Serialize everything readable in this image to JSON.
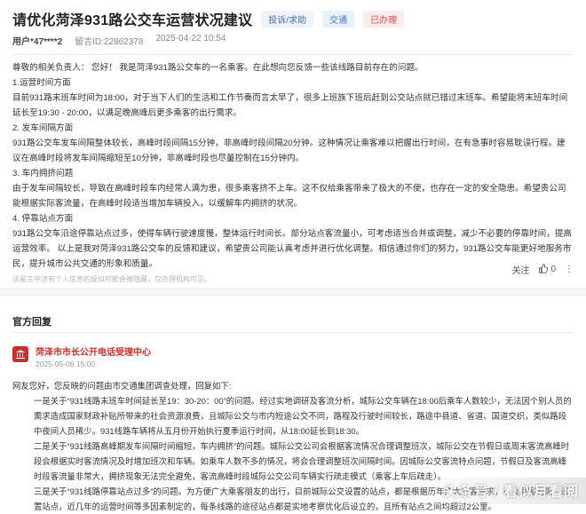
{
  "post": {
    "title": "请优化菏泽931路公交车运营状况建议",
    "tags": [
      "投诉/求助",
      "交通",
      "已办理"
    ],
    "user": "用户*47****2",
    "message_id": "留言ID:22862378",
    "datetime": "2025-04-22 10:54"
  },
  "content": {
    "greeting": "尊敬的相关负责人： 您好！ 我是菏泽931路公交车的一名乘客。在此想向您反馈一些该线路目前存在的问题。",
    "s1_title": "1.运营时间方面",
    "s1_body": "目前931路末班车时间为18:00，对于当下人们的生活和工作节奏而言太早了，很多上班族下班后赶到公交站点就已错过末班车。希望能将末班车时间延长至19:30 - 20:00，以满足晚高峰后更多乘客的出行需求。",
    "s2_title": "2. 发车间隔方面",
    "s2_body": "931路公交车发车间隔整体较长，高峰时段间隔15分钟，非高峰时段间隔20分钟。这种情况让乘客难以把握出行时间，在有急事时容易耽误行程。建议在高峰时段将发车间隔缩短至10分钟，非高峰时段也尽量控制在15分钟内。",
    "s3_title": "3. 车内拥挤问题",
    "s3_body": "由于发车间隔较长，导致在高峰时段车内经常人满为患，很多乘客挤不上车。这不仅给乘客带来了极大的不便，也存在一定的安全隐患。希望贵公司能根据实际客流量，在高峰时段适当增加车辆投入，以缓解车内拥挤的状况。",
    "s4_title": "4. 停靠站点方面",
    "s4_body": "931路公交车沿途停靠站点过多，使得车辆行驶速度慢，整体运行时间长。部分站点客流量小，可考虑适当合并或调整，减少不必要的停靠时间，提高运营效率。 以上是我对菏泽931路公交车的反馈和建议，希望贵公司能认真考虑并进行优化调整。相信通过你们的努力，931路公交车能更好地服务市民，提升城市公共交通的形象和质量。",
    "disclaimer": "该留言中涉有个人信息的疑似可能会被隐藏，仅办理机构可见。"
  },
  "actions": {
    "follow": "关注",
    "like_count": "0"
  },
  "official": {
    "section_title": "官方回复",
    "org_name": "菏泽市市长公开电话受理中心",
    "date": "2025-05-06 15:00",
    "p1": "网友您好，您反映的问题由市交通集团调查处理，回复如下:",
    "p2": "一是关于“931线路末班车时间延长至19：30-20：00”的问题。经过实地调研及客流分析，城际公交车辆在18:00后乘车人数较少，无法因个别人员的需求造成国家财政补贴所带来的社会资源浪费，且城际公交与市内短途公交不同，路程及行驶时间较长，路途中县道、省道、国道交织，类似路段中夜间人员稀少。931线路车辆将从五月份开始执行夏季运行时间，从18:00延长到18:30。",
    "p3": "二是关于“931线路高峰期发车间隔时间缩短，车内拥挤”的问题。城际公交公司会根据客流情况合理调整班次，城际公交在节假日或周末客流高峰时段会根据实时客流情况及时增加班次和车辆。如乘车人数不多的情况，将会合理调整班次间隔时间。因城际公交客流特点问题，节假日及客流高峰时段客流量非常大，拥挤现象无法完全避免，客流高峰时段城际公交公司车辆实行疏走模式（乘客上车后疏走）。",
    "p4": "三是关于“931线路停靠站点过多”的问题。为方便广大乘客朋友的出行，目前城际公交设置的站点，都是根据历年广大乘客需求，以及乘客的需求设置站点，近几年的运营时间等多因素制定的，每条线路的途径站点都是实地考察优化后设立的，且所有站点之间均超过2公里。"
  },
  "watermark": "头条号 / 看似月看阅"
}
